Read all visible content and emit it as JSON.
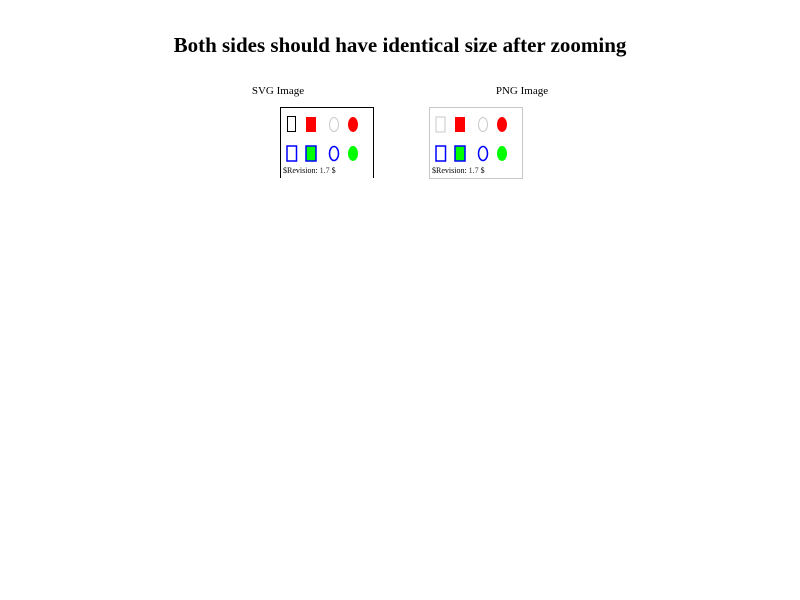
{
  "page": {
    "title": "Both sides should have identical size after zooming"
  },
  "columns": {
    "svg": {
      "label": "SVG Image"
    },
    "png": {
      "label": "PNG Image"
    }
  },
  "revision": {
    "prefix": "$Revision: ",
    "number": "1.7",
    "suffix": " $"
  },
  "colors": {
    "red": "#ff0000",
    "blue": "#0000ff",
    "green": "#00ff00",
    "light_gray": "#c8c8c8",
    "black": "#000000"
  }
}
